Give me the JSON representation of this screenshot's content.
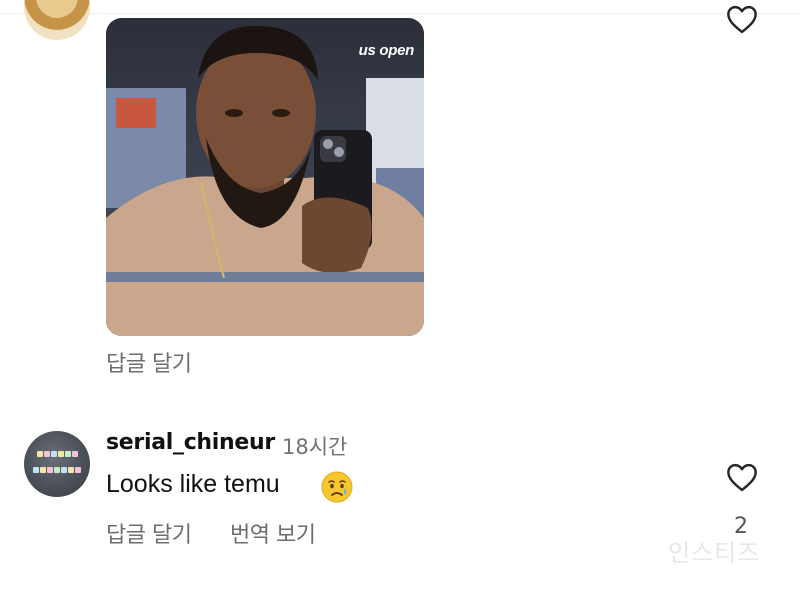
{
  "comments": [
    {
      "gif_watermark": "us open",
      "reply_label": "답글 달기"
    },
    {
      "username": "serial_chineur",
      "time": "18시간",
      "text": "Looks like temu",
      "emoji": "crying-face",
      "reply_label": "답글 달기",
      "translate_label": "번역 보기",
      "like_count": "2",
      "avatar_text": [
        "SERIAL",
        "CHINEUR"
      ]
    }
  ],
  "watermark_corner": "인스티즈",
  "colors": {
    "text": "#111111",
    "secondary": "#737373",
    "heart_stroke": "#262626"
  }
}
